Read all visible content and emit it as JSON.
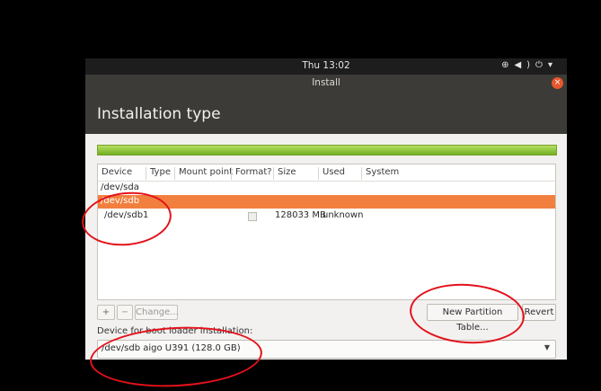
{
  "topbar": {
    "clock": "Thu 13:02",
    "icons": [
      "network-icon",
      "volume-icon",
      "power-icon",
      "menu-down-icon"
    ]
  },
  "window": {
    "title": "Install",
    "close_label": "×"
  },
  "page": {
    "title": "Installation type"
  },
  "table": {
    "columns": [
      "Device",
      "Type",
      "Mount point",
      "Format?",
      "Size",
      "Used",
      "System"
    ],
    "rows": [
      {
        "device": "/dev/sda",
        "type": "",
        "mount": "",
        "format": false,
        "size": "",
        "used": "",
        "system": "",
        "selected": false
      },
      {
        "device": "/dev/sdb",
        "type": "",
        "mount": "",
        "format": false,
        "size": "",
        "used": "",
        "system": "",
        "selected": true
      },
      {
        "device": "/dev/sdb1",
        "type": "",
        "mount": "",
        "format": false,
        "size": "128033 MB",
        "used": "unknown",
        "system": "",
        "selected": false
      }
    ]
  },
  "toolbar": {
    "add_label": "+",
    "remove_label": "−",
    "change_label": "Change...",
    "new_table_label": "New Partition Table...",
    "revert_label": "Revert"
  },
  "bootloader": {
    "label": "Device for boot loader installation:",
    "value": "/dev/sdb aigo U391 (128.0 GB)"
  },
  "colors": {
    "accent": "#f17f3e",
    "annotation": "#e3121b",
    "progress": "#8fc93a"
  }
}
